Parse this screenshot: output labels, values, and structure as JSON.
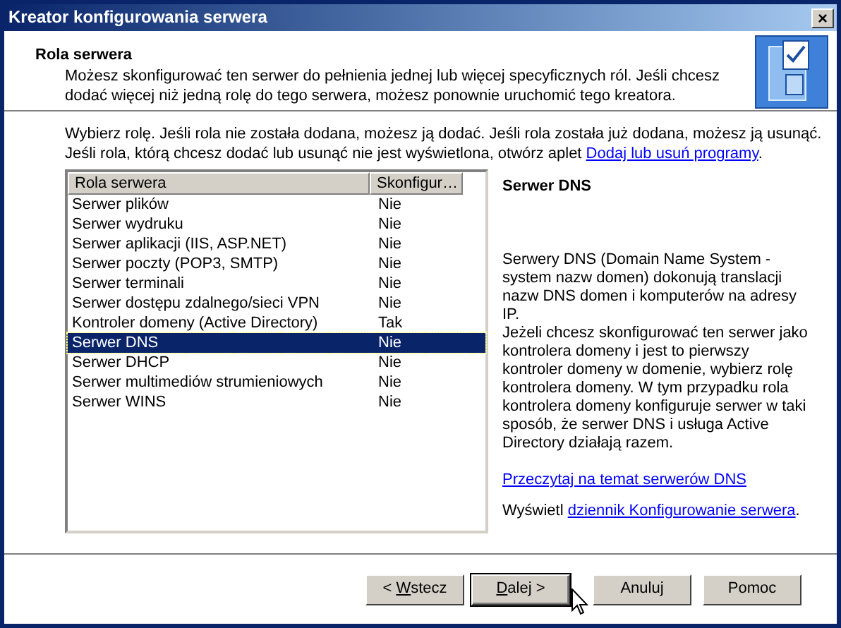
{
  "window": {
    "title": "Kreator konfigurowania serwera",
    "close": "×"
  },
  "header": {
    "title": "Rola serwera",
    "subtitle": "Możesz skonfigurować ten serwer do pełnienia jednej lub więcej specyficznych ról. Jeśli chcesz dodać więcej niż jedną rolę do tego serwera, możesz ponownie uruchomić tego kreatora."
  },
  "intro": {
    "text": "Wybierz rolę. Jeśli rola nie została dodana, możesz ją dodać. Jeśli rola została już dodana, możesz ją usunąć. Jeśli rola, którą chcesz dodać lub usunąć nie jest wyświetlona, otwórz aplet ",
    "link": "Dodaj lub usuń programy",
    "after": "."
  },
  "table": {
    "columns": [
      "Rola serwera",
      "Skonfigur…"
    ],
    "rows": [
      {
        "cells": [
          "Serwer plików",
          "Nie"
        ],
        "selected": false
      },
      {
        "cells": [
          "Serwer wydruku",
          "Nie"
        ],
        "selected": false
      },
      {
        "cells": [
          "Serwer aplikacji (IIS, ASP.NET)",
          "Nie"
        ],
        "selected": false
      },
      {
        "cells": [
          "Serwer poczty (POP3, SMTP)",
          "Nie"
        ],
        "selected": false
      },
      {
        "cells": [
          "Serwer terminali",
          "Nie"
        ],
        "selected": false
      },
      {
        "cells": [
          "Serwer dostępu zdalnego/sieci VPN",
          "Nie"
        ],
        "selected": false
      },
      {
        "cells": [
          "Kontroler domeny (Active Directory)",
          "Tak"
        ],
        "selected": false
      },
      {
        "cells": [
          "Serwer DNS",
          "Nie"
        ],
        "selected": true
      },
      {
        "cells": [
          "Serwer DHCP",
          "Nie"
        ],
        "selected": false
      },
      {
        "cells": [
          "Serwer multimediów strumieniowych",
          "Nie"
        ],
        "selected": false
      },
      {
        "cells": [
          "Serwer WINS",
          "Nie"
        ],
        "selected": false
      }
    ]
  },
  "details": {
    "title": "Serwer DNS",
    "description": "Serwery DNS (Domain Name System - system nazw domen) dokonują translacji nazw DNS domen i komputerów na adresy IP.\nJeżeli chcesz skonfigurować ten serwer jako kontrolera domeny i jest to pierwszy kontroler domeny w domenie, wybierz rolę kontrolera domeny. W tym przypadku rola kontrolera domeny konfiguruje serwer w taki sposób, że serwer DNS i usługa Active Directory działają razem.",
    "read_more": "Przeczytaj na temat serwerów DNS",
    "log": {
      "text": "Wyświetl ",
      "link": "dziennik Konfigurowanie serwera",
      "after": "."
    }
  },
  "buttons": [
    {
      "before": "< ",
      "key": "W",
      "after": "stecz",
      "default": false
    },
    {
      "key": "D",
      "after": "alej >",
      "default": true
    },
    {
      "before": "Anuluj",
      "default": false
    },
    {
      "before": "Pomoc",
      "default": false
    }
  ]
}
